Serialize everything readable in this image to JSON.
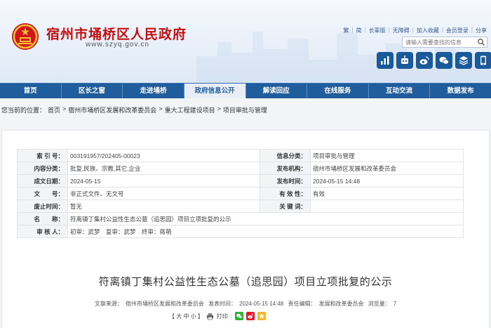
{
  "header": {
    "site_title": "宿州市埇桥区人民政府",
    "site_url": "www.szyq.gov.cn",
    "top_links": [
      "繁",
      "简",
      "长辈版",
      "无障碍",
      "加入收藏",
      "会员登录",
      "分享"
    ],
    "search_placeholder": "请输入需要查找的信息"
  },
  "nav": {
    "items": [
      "首页",
      "区长之窗",
      "走进埇桥",
      "政府信息公开",
      "解读回应",
      "在线服务",
      "互动交流",
      "数据发布"
    ],
    "active_index": 3
  },
  "breadcrumb": {
    "prefix": "您当前的位置：",
    "items": [
      "首页",
      "宿州市埇桥区发展和改革委员会",
      "重大工程建设项目",
      "项目审批与管理"
    ],
    "separator": ">"
  },
  "info": {
    "index_label": "索 引 号：",
    "index_value": "003191957/202405-00023",
    "category_label": "信息分类：",
    "category_value": "项目审批与管理",
    "content_label": "内容分类：",
    "content_value": "批复,民族、宗教,其它,企业",
    "publisher_label": "发布机构：",
    "publisher_value": "宿州市埇桥区发展和改革委员会",
    "created_label": "成文日期：",
    "created_value": "2024-05-15",
    "published_label": "发布时间：",
    "published_value": "2024-05-15 14:48",
    "docno_label": "文　　号：",
    "docno_value": "非正式文件、无文号",
    "validity_label": "有 效 性：",
    "validity_value": "有效",
    "abolish_label": "废止时间：",
    "abolish_value": "暂无",
    "keywords_label": "关 键 词：",
    "keywords_value": "",
    "name_label": "名　　称：",
    "name_value": "符离镇丁集村公益性生态公墓（追思园）项目立项批复的公示",
    "reviewer_label": "审 核 人：",
    "reviewer_value": "初审：武梦　复审：武梦　终审：蒋萌"
  },
  "document": {
    "title": "符离镇丁集村公益性生态公墓（追思园）项目立项批复的公示",
    "source_label": "文章来源：",
    "source_value": "宿州市埇桥区发展和改革委员会",
    "time_label": "发表时间：",
    "time_value": "2024-05-15 14:48",
    "editor_label": "责任编辑：",
    "editor_value": "发展和改革委员会",
    "views_label": "浏览量：",
    "views_value": "7"
  },
  "tools": {
    "font_size": "【 大 中 小 】",
    "print": "打印"
  },
  "colors": {
    "brand_red": "#c40f10",
    "nav_blue": "#1f5d9c",
    "wechat_green": "#2db12e",
    "weibo_red": "#e6162d",
    "qzone_yellow": "#f7b52c"
  }
}
